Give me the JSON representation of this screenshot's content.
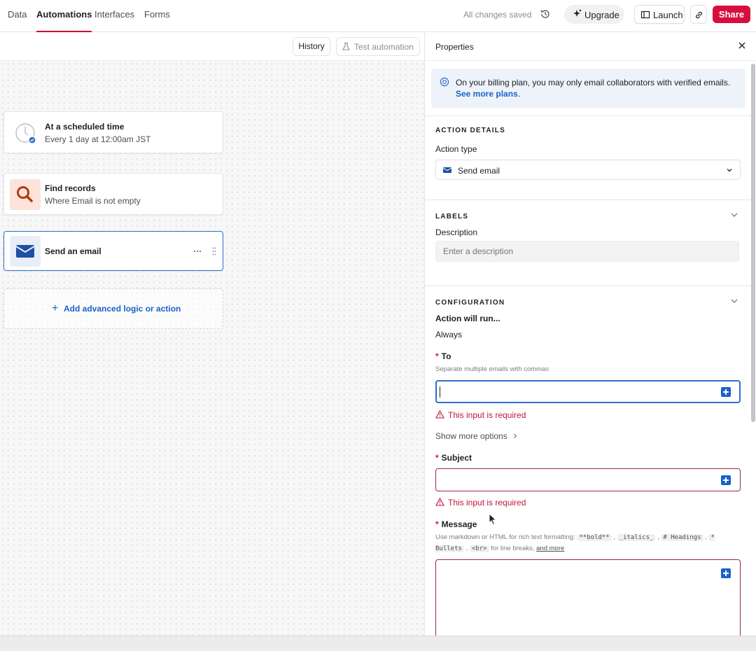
{
  "nav": {
    "tabs": [
      {
        "label": "Data"
      },
      {
        "label": "Automations"
      },
      {
        "label": "Interfaces"
      },
      {
        "label": "Forms"
      }
    ],
    "status": "All changes saved",
    "upgrade": "Upgrade",
    "launch": "Launch",
    "share": "Share"
  },
  "toolbar": {
    "history": "History",
    "test": "Test automation"
  },
  "workflow": {
    "trigger": {
      "title": "At a scheduled time",
      "subtitle": "Every 1 day at 12:00am JST"
    },
    "find": {
      "title": "Find records",
      "subtitle": "Where Email is not empty"
    },
    "email": {
      "title": "Send an email"
    },
    "add": "Add advanced logic or action"
  },
  "panel": {
    "title": "Properties",
    "info_text": "On your billing plan, you may only email collaborators with verified emails.",
    "info_link": "See more plans",
    "action_details": {
      "header": "ACTION DETAILS",
      "type_label": "Action type",
      "type_value": "Send email"
    },
    "labels": {
      "header": "LABELS",
      "desc_label": "Description",
      "desc_placeholder": "Enter a description"
    },
    "configuration": {
      "header": "CONFIGURATION",
      "run_label": "Action will run...",
      "run_value": "Always",
      "to_label": "To",
      "to_hint": "Separate multiple emails with commas",
      "error": "This input is required",
      "more_options": "Show more options",
      "subject_label": "Subject",
      "message_label": "Message",
      "message_hint_1": "Use markdown or HTML for rich text formatting:",
      "code_bold": "**bold**",
      "code_italic": "_italics_",
      "code_heading": "# Headings",
      "code_bullets": "* Bullets",
      "code_br": "<br>",
      "hint_linebreaks": "for line breaks,",
      "hint_more": "and more"
    }
  },
  "colors": {
    "accent": "#d60f3c",
    "link": "#1a62c9",
    "selected": "#2d6fc9"
  }
}
